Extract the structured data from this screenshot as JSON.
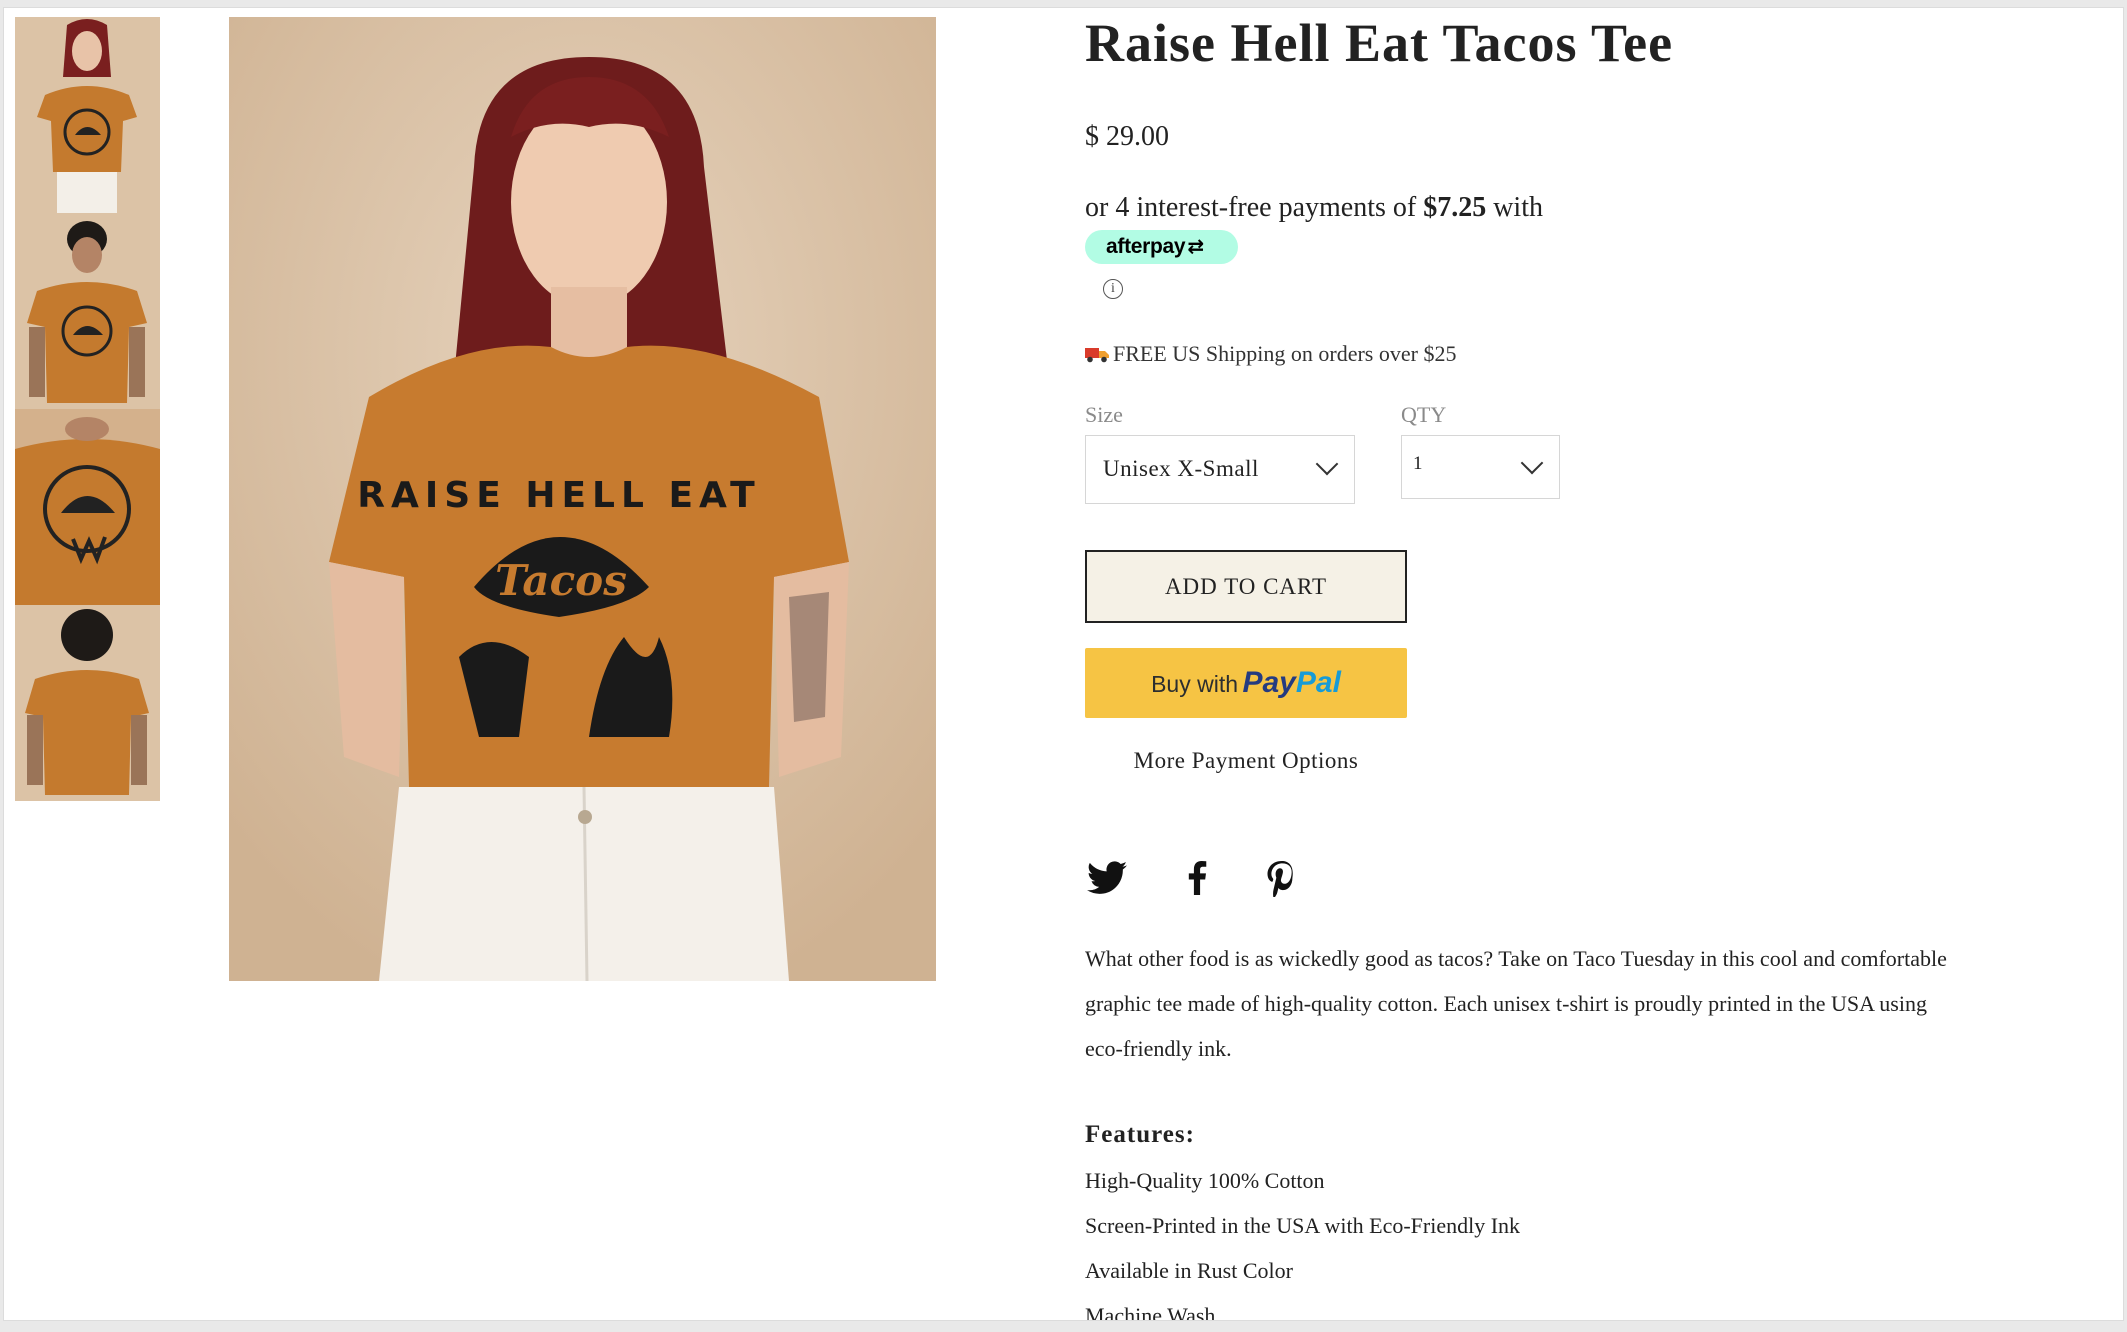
{
  "product": {
    "title": "Raise Hell Eat Tacos Tee",
    "price": "$ 29.00",
    "afterpay": {
      "text_before": "or 4 interest-free payments of ",
      "amount": "$7.25",
      "text_after": " with",
      "badge_label": "afterpay",
      "badge_color": "#b2fce4",
      "info_symbol": "i"
    },
    "shipping": "FREE US Shipping on orders over $25",
    "size": {
      "label": "Size",
      "value": "Unisex X-Small"
    },
    "qty": {
      "label": "QTY",
      "value": "1"
    },
    "add_to_cart_label": "ADD TO CART",
    "paypal": {
      "buy_with": "Buy with",
      "pay": "Pay",
      "pal": "Pal",
      "color": "#f6c444"
    },
    "more_payment_options": "More Payment Options",
    "description": "What other food is as wickedly good as tacos? Take on Taco Tuesday in this cool and comfortable graphic tee made of high-quality cotton. Each unisex t-shirt is proudly printed in the USA using eco-friendly ink.",
    "features_heading": "Features:",
    "features": [
      "High-Quality 100% Cotton",
      "Screen-Printed in the USA with Eco-Friendly Ink",
      "Available in Rust Color",
      "Machine Wash"
    ],
    "shirt_text": "RAISE HELL EAT",
    "shirt_logo_text": "Tacos"
  },
  "social": [
    "twitter-icon",
    "facebook-icon",
    "pinterest-icon"
  ],
  "images": [
    "thumbnail-woman-front",
    "thumbnail-man-front",
    "thumbnail-shirt-closeup",
    "thumbnail-back"
  ]
}
